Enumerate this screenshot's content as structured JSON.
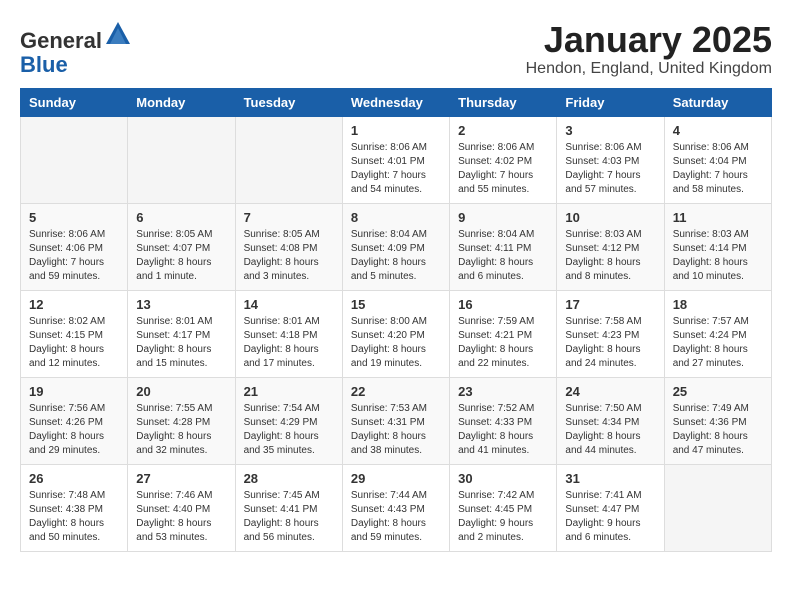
{
  "logo": {
    "general": "General",
    "blue": "Blue"
  },
  "header": {
    "month": "January 2025",
    "location": "Hendon, England, United Kingdom"
  },
  "weekdays": [
    "Sunday",
    "Monday",
    "Tuesday",
    "Wednesday",
    "Thursday",
    "Friday",
    "Saturday"
  ],
  "weeks": [
    [
      {
        "day": "",
        "empty": true
      },
      {
        "day": "",
        "empty": true
      },
      {
        "day": "",
        "empty": true
      },
      {
        "day": "1",
        "sunrise": "8:06 AM",
        "sunset": "4:01 PM",
        "daylight": "7 hours and 54 minutes."
      },
      {
        "day": "2",
        "sunrise": "8:06 AM",
        "sunset": "4:02 PM",
        "daylight": "7 hours and 55 minutes."
      },
      {
        "day": "3",
        "sunrise": "8:06 AM",
        "sunset": "4:03 PM",
        "daylight": "7 hours and 57 minutes."
      },
      {
        "day": "4",
        "sunrise": "8:06 AM",
        "sunset": "4:04 PM",
        "daylight": "7 hours and 58 minutes."
      }
    ],
    [
      {
        "day": "5",
        "sunrise": "8:06 AM",
        "sunset": "4:06 PM",
        "daylight": "7 hours and 59 minutes."
      },
      {
        "day": "6",
        "sunrise": "8:05 AM",
        "sunset": "4:07 PM",
        "daylight": "8 hours and 1 minute."
      },
      {
        "day": "7",
        "sunrise": "8:05 AM",
        "sunset": "4:08 PM",
        "daylight": "8 hours and 3 minutes."
      },
      {
        "day": "8",
        "sunrise": "8:04 AM",
        "sunset": "4:09 PM",
        "daylight": "8 hours and 5 minutes."
      },
      {
        "day": "9",
        "sunrise": "8:04 AM",
        "sunset": "4:11 PM",
        "daylight": "8 hours and 6 minutes."
      },
      {
        "day": "10",
        "sunrise": "8:03 AM",
        "sunset": "4:12 PM",
        "daylight": "8 hours and 8 minutes."
      },
      {
        "day": "11",
        "sunrise": "8:03 AM",
        "sunset": "4:14 PM",
        "daylight": "8 hours and 10 minutes."
      }
    ],
    [
      {
        "day": "12",
        "sunrise": "8:02 AM",
        "sunset": "4:15 PM",
        "daylight": "8 hours and 12 minutes."
      },
      {
        "day": "13",
        "sunrise": "8:01 AM",
        "sunset": "4:17 PM",
        "daylight": "8 hours and 15 minutes."
      },
      {
        "day": "14",
        "sunrise": "8:01 AM",
        "sunset": "4:18 PM",
        "daylight": "8 hours and 17 minutes."
      },
      {
        "day": "15",
        "sunrise": "8:00 AM",
        "sunset": "4:20 PM",
        "daylight": "8 hours and 19 minutes."
      },
      {
        "day": "16",
        "sunrise": "7:59 AM",
        "sunset": "4:21 PM",
        "daylight": "8 hours and 22 minutes."
      },
      {
        "day": "17",
        "sunrise": "7:58 AM",
        "sunset": "4:23 PM",
        "daylight": "8 hours and 24 minutes."
      },
      {
        "day": "18",
        "sunrise": "7:57 AM",
        "sunset": "4:24 PM",
        "daylight": "8 hours and 27 minutes."
      }
    ],
    [
      {
        "day": "19",
        "sunrise": "7:56 AM",
        "sunset": "4:26 PM",
        "daylight": "8 hours and 29 minutes."
      },
      {
        "day": "20",
        "sunrise": "7:55 AM",
        "sunset": "4:28 PM",
        "daylight": "8 hours and 32 minutes."
      },
      {
        "day": "21",
        "sunrise": "7:54 AM",
        "sunset": "4:29 PM",
        "daylight": "8 hours and 35 minutes."
      },
      {
        "day": "22",
        "sunrise": "7:53 AM",
        "sunset": "4:31 PM",
        "daylight": "8 hours and 38 minutes."
      },
      {
        "day": "23",
        "sunrise": "7:52 AM",
        "sunset": "4:33 PM",
        "daylight": "8 hours and 41 minutes."
      },
      {
        "day": "24",
        "sunrise": "7:50 AM",
        "sunset": "4:34 PM",
        "daylight": "8 hours and 44 minutes."
      },
      {
        "day": "25",
        "sunrise": "7:49 AM",
        "sunset": "4:36 PM",
        "daylight": "8 hours and 47 minutes."
      }
    ],
    [
      {
        "day": "26",
        "sunrise": "7:48 AM",
        "sunset": "4:38 PM",
        "daylight": "8 hours and 50 minutes."
      },
      {
        "day": "27",
        "sunrise": "7:46 AM",
        "sunset": "4:40 PM",
        "daylight": "8 hours and 53 minutes."
      },
      {
        "day": "28",
        "sunrise": "7:45 AM",
        "sunset": "4:41 PM",
        "daylight": "8 hours and 56 minutes."
      },
      {
        "day": "29",
        "sunrise": "7:44 AM",
        "sunset": "4:43 PM",
        "daylight": "8 hours and 59 minutes."
      },
      {
        "day": "30",
        "sunrise": "7:42 AM",
        "sunset": "4:45 PM",
        "daylight": "9 hours and 2 minutes."
      },
      {
        "day": "31",
        "sunrise": "7:41 AM",
        "sunset": "4:47 PM",
        "daylight": "9 hours and 6 minutes."
      },
      {
        "day": "",
        "empty": true
      }
    ]
  ]
}
